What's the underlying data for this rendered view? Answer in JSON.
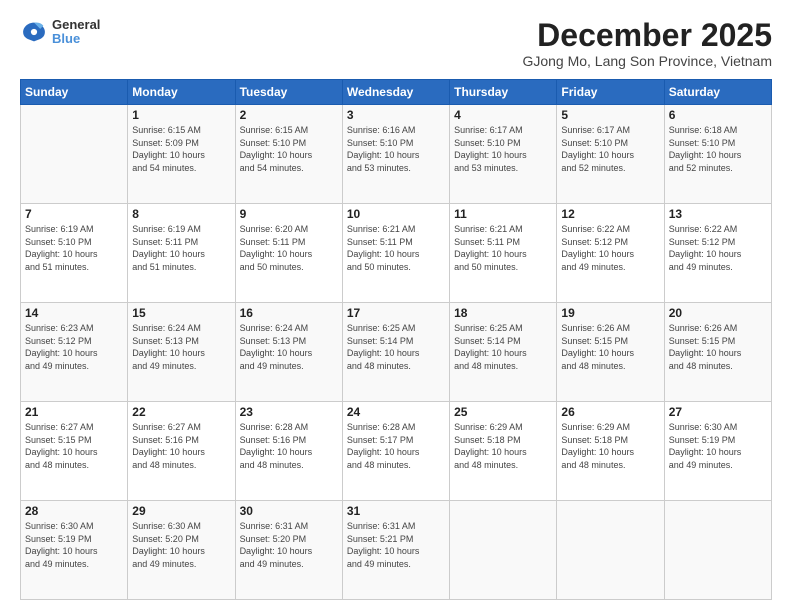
{
  "header": {
    "logo": {
      "line1": "General",
      "line2": "Blue"
    },
    "title": "December 2025",
    "subtitle": "GJong Mo, Lang Son Province, Vietnam"
  },
  "weekdays": [
    "Sunday",
    "Monday",
    "Tuesday",
    "Wednesday",
    "Thursday",
    "Friday",
    "Saturday"
  ],
  "weeks": [
    [
      {
        "day": "",
        "info": ""
      },
      {
        "day": "1",
        "info": "Sunrise: 6:15 AM\nSunset: 5:09 PM\nDaylight: 10 hours\nand 54 minutes."
      },
      {
        "day": "2",
        "info": "Sunrise: 6:15 AM\nSunset: 5:10 PM\nDaylight: 10 hours\nand 54 minutes."
      },
      {
        "day": "3",
        "info": "Sunrise: 6:16 AM\nSunset: 5:10 PM\nDaylight: 10 hours\nand 53 minutes."
      },
      {
        "day": "4",
        "info": "Sunrise: 6:17 AM\nSunset: 5:10 PM\nDaylight: 10 hours\nand 53 minutes."
      },
      {
        "day": "5",
        "info": "Sunrise: 6:17 AM\nSunset: 5:10 PM\nDaylight: 10 hours\nand 52 minutes."
      },
      {
        "day": "6",
        "info": "Sunrise: 6:18 AM\nSunset: 5:10 PM\nDaylight: 10 hours\nand 52 minutes."
      }
    ],
    [
      {
        "day": "7",
        "info": "Sunrise: 6:19 AM\nSunset: 5:10 PM\nDaylight: 10 hours\nand 51 minutes."
      },
      {
        "day": "8",
        "info": "Sunrise: 6:19 AM\nSunset: 5:11 PM\nDaylight: 10 hours\nand 51 minutes."
      },
      {
        "day": "9",
        "info": "Sunrise: 6:20 AM\nSunset: 5:11 PM\nDaylight: 10 hours\nand 50 minutes."
      },
      {
        "day": "10",
        "info": "Sunrise: 6:21 AM\nSunset: 5:11 PM\nDaylight: 10 hours\nand 50 minutes."
      },
      {
        "day": "11",
        "info": "Sunrise: 6:21 AM\nSunset: 5:11 PM\nDaylight: 10 hours\nand 50 minutes."
      },
      {
        "day": "12",
        "info": "Sunrise: 6:22 AM\nSunset: 5:12 PM\nDaylight: 10 hours\nand 49 minutes."
      },
      {
        "day": "13",
        "info": "Sunrise: 6:22 AM\nSunset: 5:12 PM\nDaylight: 10 hours\nand 49 minutes."
      }
    ],
    [
      {
        "day": "14",
        "info": "Sunrise: 6:23 AM\nSunset: 5:12 PM\nDaylight: 10 hours\nand 49 minutes."
      },
      {
        "day": "15",
        "info": "Sunrise: 6:24 AM\nSunset: 5:13 PM\nDaylight: 10 hours\nand 49 minutes."
      },
      {
        "day": "16",
        "info": "Sunrise: 6:24 AM\nSunset: 5:13 PM\nDaylight: 10 hours\nand 49 minutes."
      },
      {
        "day": "17",
        "info": "Sunrise: 6:25 AM\nSunset: 5:14 PM\nDaylight: 10 hours\nand 48 minutes."
      },
      {
        "day": "18",
        "info": "Sunrise: 6:25 AM\nSunset: 5:14 PM\nDaylight: 10 hours\nand 48 minutes."
      },
      {
        "day": "19",
        "info": "Sunrise: 6:26 AM\nSunset: 5:15 PM\nDaylight: 10 hours\nand 48 minutes."
      },
      {
        "day": "20",
        "info": "Sunrise: 6:26 AM\nSunset: 5:15 PM\nDaylight: 10 hours\nand 48 minutes."
      }
    ],
    [
      {
        "day": "21",
        "info": "Sunrise: 6:27 AM\nSunset: 5:15 PM\nDaylight: 10 hours\nand 48 minutes."
      },
      {
        "day": "22",
        "info": "Sunrise: 6:27 AM\nSunset: 5:16 PM\nDaylight: 10 hours\nand 48 minutes."
      },
      {
        "day": "23",
        "info": "Sunrise: 6:28 AM\nSunset: 5:16 PM\nDaylight: 10 hours\nand 48 minutes."
      },
      {
        "day": "24",
        "info": "Sunrise: 6:28 AM\nSunset: 5:17 PM\nDaylight: 10 hours\nand 48 minutes."
      },
      {
        "day": "25",
        "info": "Sunrise: 6:29 AM\nSunset: 5:18 PM\nDaylight: 10 hours\nand 48 minutes."
      },
      {
        "day": "26",
        "info": "Sunrise: 6:29 AM\nSunset: 5:18 PM\nDaylight: 10 hours\nand 48 minutes."
      },
      {
        "day": "27",
        "info": "Sunrise: 6:30 AM\nSunset: 5:19 PM\nDaylight: 10 hours\nand 49 minutes."
      }
    ],
    [
      {
        "day": "28",
        "info": "Sunrise: 6:30 AM\nSunset: 5:19 PM\nDaylight: 10 hours\nand 49 minutes."
      },
      {
        "day": "29",
        "info": "Sunrise: 6:30 AM\nSunset: 5:20 PM\nDaylight: 10 hours\nand 49 minutes."
      },
      {
        "day": "30",
        "info": "Sunrise: 6:31 AM\nSunset: 5:20 PM\nDaylight: 10 hours\nand 49 minutes."
      },
      {
        "day": "31",
        "info": "Sunrise: 6:31 AM\nSunset: 5:21 PM\nDaylight: 10 hours\nand 49 minutes."
      },
      {
        "day": "",
        "info": ""
      },
      {
        "day": "",
        "info": ""
      },
      {
        "day": "",
        "info": ""
      }
    ]
  ]
}
